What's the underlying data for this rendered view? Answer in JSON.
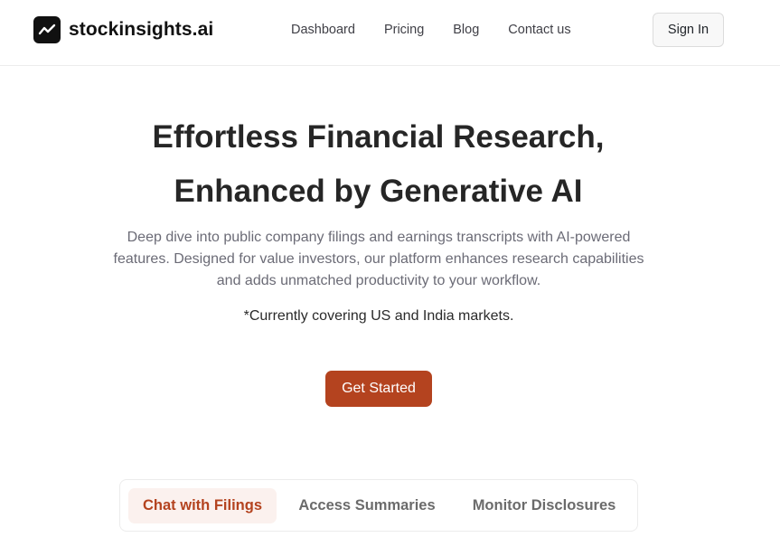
{
  "brand": {
    "name": "stockinsights.ai",
    "icon": "trend-line-icon"
  },
  "nav": {
    "items": [
      "Dashboard",
      "Pricing",
      "Blog",
      "Contact us"
    ],
    "sign_in_label": "Sign In"
  },
  "hero": {
    "title_line1": "Effortless Financial Research,",
    "title_line2": "Enhanced by Generative AI",
    "description": "Deep dive into public company filings and earnings transcripts with AI-powered features. Designed for value investors, our platform enhances research capabilities and adds unmatched productivity to your workflow.",
    "note": "*Currently covering US and India markets.",
    "cta_label": "Get Started"
  },
  "tabs": {
    "items": [
      "Chat with Filings",
      "Access Summaries",
      "Monitor Disclosures"
    ],
    "active_index": 0
  },
  "colors": {
    "accent": "#b4431f",
    "accent_light": "#fbf1ee",
    "text_dark": "#262626",
    "text_muted": "#6b6b76"
  }
}
